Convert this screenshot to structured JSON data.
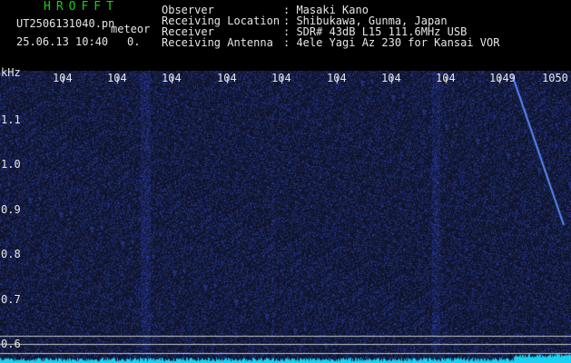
{
  "header": {
    "app_title": "HROFFT",
    "file_name": "UT2506131040.pn",
    "mode_label": "meteor",
    "timestamp": "25.06.13 10:40",
    "count": "0.",
    "observer_label": "Observer",
    "observer_value": ": Masaki Kano",
    "location_label": "Receiving Location",
    "location_value": ": Shibukawa, Gunma, Japan",
    "receiver_label": "Receiver",
    "receiver_value": ": SDR# 43dB L15 111.6MHz USB",
    "antenna_label": "Receiving Antenna",
    "antenna_value": ": 4ele Yagi Az 230 for Kansai VOR"
  },
  "axes": {
    "y_unit": "kHz",
    "y_ticks": [
      "1.1",
      "1.0",
      "0.9",
      "0.8",
      "0.7",
      "0.6"
    ],
    "time_labels": [
      "104",
      "104",
      "104",
      "104",
      "104",
      "104",
      "104",
      "104",
      "1049",
      "1050"
    ]
  },
  "colors": {
    "background": "#000000",
    "spectrum_bg": "#000010",
    "noise": "#2a3fc0",
    "echo_trace": "#5a8cff",
    "baseline": "#19d2f0",
    "axis_text": "#e6e6e6",
    "title": "#14d214"
  }
}
